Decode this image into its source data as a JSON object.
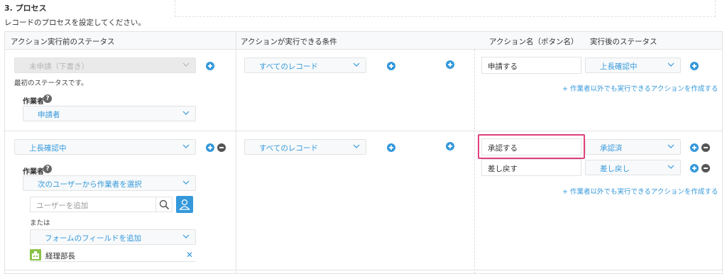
{
  "section": {
    "title": "3. プロセス",
    "description": "レコードのプロセスを設定してください。"
  },
  "columns": {
    "status_before": "アクション実行前のステータス",
    "condition": "アクションが実行できる条件",
    "action_name": "アクション名（ボタン名）",
    "status_after": "実行後のステータス"
  },
  "row1": {
    "status": "未申請（下書き）",
    "first_status_note": "最初のステータスです。",
    "assignee_label": "作業者",
    "assignee_value": "申請者",
    "condition": "すべてのレコード",
    "actions": [
      {
        "name": "申請する",
        "next_status": "上長確認中"
      }
    ],
    "create_link": "作業者以外でも実行できるアクションを作成する"
  },
  "row2": {
    "status": "上長確認中",
    "assignee_label": "作業者",
    "assignee_mode": "次のユーザーから作業者を選択",
    "user_search_placeholder": "ユーザーを追加",
    "or_label": "または",
    "field_select": "フォームのフィールドを追加",
    "assignee_entry": "経理部長",
    "condition": "すべてのレコード",
    "actions": [
      {
        "name": "承認する",
        "next_status": "承認済"
      },
      {
        "name": "差し戻す",
        "next_status": "差し戻し"
      }
    ],
    "create_link": "作業者以外でも実行できるアクションを作成する"
  },
  "icons": {
    "help": "?",
    "remove_entry": "✕",
    "link_plus": "+"
  },
  "colors": {
    "accent": "#3498db",
    "highlight": "#e0407c",
    "org_icon": "#8bc34a"
  }
}
